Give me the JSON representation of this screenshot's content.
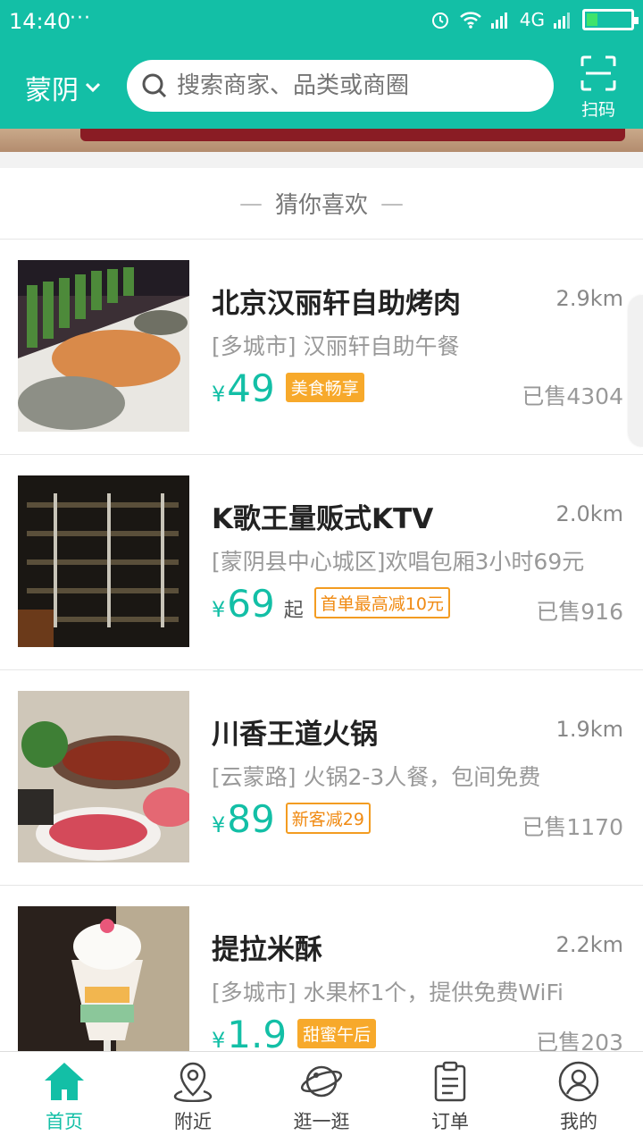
{
  "status": {
    "time": "14:40",
    "dots": "···",
    "network": "4G"
  },
  "header": {
    "city": "蒙阴",
    "search_placeholder": "搜索商家、品类或商圈",
    "scan_label": "扫码",
    "accent": "#13bfa6"
  },
  "section": {
    "title": "猜你喜欢",
    "dash": "—"
  },
  "items": [
    {
      "name": "北京汉丽轩自助烤肉",
      "distance": "2.9km",
      "desc": "[多城市] 汉丽轩自助午餐",
      "currency": "¥",
      "price": "49",
      "suffix": "",
      "tag": "美食畅享",
      "tag_style": "fill",
      "sold": "已售4304"
    },
    {
      "name": "K歌王量贩式KTV",
      "distance": "2.0km",
      "desc": "[蒙阴县中心城区]欢唱包厢3小时69元",
      "currency": "¥",
      "price": "69",
      "suffix": "起",
      "tag": "首单最高减10元",
      "tag_style": "outline",
      "sold": "已售916"
    },
    {
      "name": "川香王道火锅",
      "distance": "1.9km",
      "desc": "[云蒙路] 火锅2-3人餐，包间免费",
      "currency": "¥",
      "price": "89",
      "suffix": "",
      "tag": "新客减29",
      "tag_style": "outline",
      "sold": "已售1170"
    },
    {
      "name": "提拉米酥",
      "distance": "2.2km",
      "desc": "[多城市] 水果杯1个，提供免费WiFi",
      "currency": "¥",
      "price": "1.9",
      "suffix": "",
      "tag": "甜蜜午后",
      "tag_style": "fill",
      "sold": "已售203"
    }
  ],
  "tabs": [
    {
      "label": "首页",
      "icon": "home-icon"
    },
    {
      "label": "附近",
      "icon": "location-pin-icon"
    },
    {
      "label": "逛一逛",
      "icon": "planet-icon"
    },
    {
      "label": "订单",
      "icon": "clipboard-icon"
    },
    {
      "label": "我的",
      "icon": "user-icon"
    }
  ]
}
